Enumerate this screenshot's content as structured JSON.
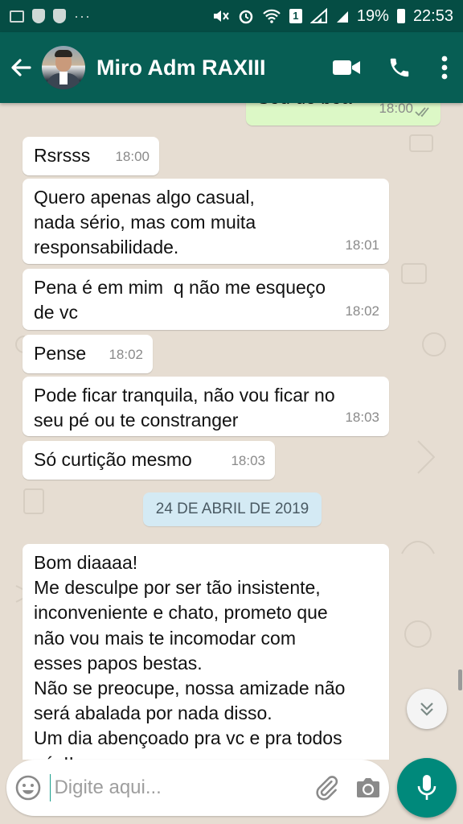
{
  "status_bar": {
    "more_indicator": "···",
    "sim_label": "1",
    "battery": "19%",
    "time": "22:53"
  },
  "header": {
    "back_icon": "arrow-left-icon",
    "contact_name": "Miro Adm RAXIII",
    "video_icon": "videocam-icon",
    "call_icon": "phone-icon",
    "menu_icon": "more-vert-icon"
  },
  "colors": {
    "header": "#075e54",
    "status_bar": "#054d44",
    "chat_bg": "#e6ddd2",
    "outgoing_bubble": "#dcf8c6",
    "date_chip": "#d4eaf4",
    "accent": "#00897b"
  },
  "messages": [
    {
      "direction": "out",
      "text": "Sou de boa",
      "time": "18:00",
      "status": "read"
    },
    {
      "direction": "in",
      "text": "Rsrsss",
      "time": "18:00"
    },
    {
      "direction": "in",
      "text": "Quero apenas algo casual,\nnada sério, mas com muita\nresponsabilidade.",
      "time": "18:01"
    },
    {
      "direction": "in",
      "text": "Pena é em mim  q não me esqueço\nde vc",
      "time": "18:02"
    },
    {
      "direction": "in",
      "text": "Pense",
      "time": "18:02"
    },
    {
      "direction": "in",
      "text": "Pode ficar tranquila, não vou ficar no\nseu pé ou te constranger",
      "time": "18:03"
    },
    {
      "direction": "in",
      "text": "Só curtição mesmo",
      "time": "18:03"
    },
    {
      "direction": "in",
      "text": "Bom diaaaa!\nMe desculpe por ser tão insistente,\ninconveniente e chato, prometo que\nnão vou mais te incomodar com\nesses papos bestas.\nNão se preocupe, nossa amizade não\nserá abalada por nada disso.\nUm dia abençoado pra vc e pra todos\nnós!!",
      "time": ""
    }
  ],
  "date_separator": "24 DE ABRIL DE 2019",
  "composer": {
    "placeholder": "Digite aqui...",
    "emoji_icon": "emoji-icon",
    "attach_icon": "paperclip-icon",
    "camera_icon": "camera-icon",
    "mic_icon": "mic-icon"
  },
  "scroll_down_icon": "chevron-double-down-icon"
}
